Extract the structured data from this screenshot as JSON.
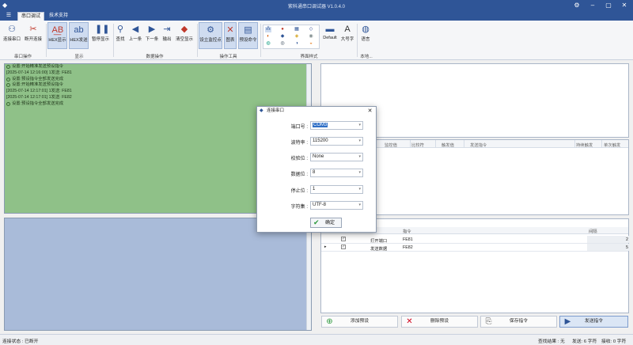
{
  "window": {
    "title": "紫科通串口调试器 V1.0.4.0",
    "app_icon": "app-icon",
    "controls": [
      "settings-icon",
      "minimize-icon",
      "maximize-icon",
      "close-icon"
    ]
  },
  "tabs": [
    {
      "label": "串口调试"
    },
    {
      "label": "技术支持"
    }
  ],
  "ribbon": {
    "groups": [
      {
        "label": "串口操作",
        "buttons": [
          {
            "label": "连接串口",
            "icon": "connect-icon"
          },
          {
            "label": "断开连接",
            "icon": "disconnect-icon"
          }
        ]
      },
      {
        "label": "显示",
        "buttons": [
          {
            "label": "HEX显示",
            "icon": "hex-display-icon"
          },
          {
            "label": "HEX发送",
            "icon": "hex-send-icon"
          },
          {
            "label": "暂停显示",
            "icon": "pause-icon"
          }
        ]
      },
      {
        "label": "数据操作",
        "buttons": [
          {
            "label": "查找",
            "icon": "search-icon"
          },
          {
            "label": "上一条",
            "icon": "prev-icon"
          },
          {
            "label": "下一条",
            "icon": "next-icon"
          },
          {
            "label": "输出",
            "icon": "export-icon"
          },
          {
            "label": "清空显示",
            "icon": "eraser-icon"
          }
        ]
      },
      {
        "label": "操作工具",
        "buttons": [
          {
            "label": "设立监控点",
            "icon": "monitor-point-icon"
          },
          {
            "label": "图表",
            "icon": "chart-icon"
          },
          {
            "label": "预设命令",
            "icon": "preset-icon"
          }
        ]
      },
      {
        "label": "界面样式",
        "theme_label": "Default",
        "font_label": "大号字"
      },
      {
        "label": "本地...",
        "buttons": [
          {
            "label": "语言",
            "icon": "globe-icon"
          }
        ]
      }
    ]
  },
  "receive_log": [
    "设置:开始精准发送预设指令",
    "[2025-07-14 12:16:00] 1发送: FE81",
    "设置:预设指令全部发送完成",
    "设置:开始精准发送预设指令",
    "[2025-07-14 12:17:01] 1发送: FE81",
    "[2025-07-14 12:17:01] 1发送: FE82",
    "设置:预设指令全部发送完成"
  ],
  "monitor_table": {
    "columns": [
      "监控值",
      "比较符",
      "触发值",
      "发送指令",
      "持续触发",
      "单次触发"
    ]
  },
  "preset_table": {
    "columns": [
      "指令",
      "间隔"
    ],
    "rows": [
      {
        "checked": true,
        "name": "打开端口",
        "command": "FE81",
        "interval": "2"
      },
      {
        "checked": true,
        "name": "发送数据",
        "command": "FE82",
        "interval": "5"
      }
    ]
  },
  "bottom_buttons": [
    {
      "label": "添加预设",
      "icon": "add-icon"
    },
    {
      "label": "删除预设",
      "icon": "delete-icon"
    },
    {
      "label": "保存指令",
      "icon": "save-icon"
    },
    {
      "label": "发送指令",
      "icon": "play-icon"
    }
  ],
  "status": {
    "left": "连接状态 : 已断开",
    "find": "查找结果 : 无",
    "sent": "发送: 6 字符",
    "recv": "接收: 0 字符"
  },
  "dialog": {
    "title": "连接串口",
    "fields": [
      {
        "label": "端口号 :",
        "value": "COM3"
      },
      {
        "label": "波特率 :",
        "value": "115200"
      },
      {
        "label": "校验位 :",
        "value": "None"
      },
      {
        "label": "数据位 :",
        "value": "8"
      },
      {
        "label": "停止位 :",
        "value": "1"
      },
      {
        "label": "字符集 :",
        "value": "UTF-8"
      }
    ],
    "ok_label": "确定"
  }
}
